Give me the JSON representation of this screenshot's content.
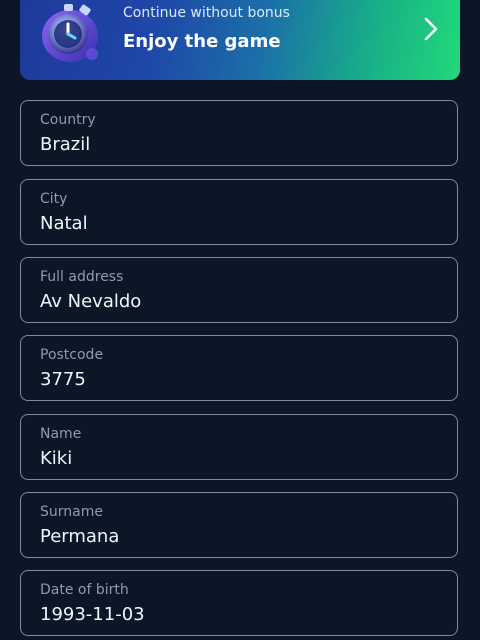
{
  "banner": {
    "subtitle": "Continue without bonus",
    "title": "Enjoy the game",
    "art_icon": "stopwatch-icon",
    "chevron_icon": "chevron-right-icon",
    "gradient_colors": [
      "#1d3a9c",
      "#1b6fa8",
      "#22d97a"
    ]
  },
  "form": {
    "fields": [
      {
        "label": "Country",
        "value": "Brazil"
      },
      {
        "label": "City",
        "value": "Natal"
      },
      {
        "label": "Full address",
        "value": "Av Nevaldo"
      },
      {
        "label": "Postcode",
        "value": "3775"
      },
      {
        "label": "Name",
        "value": "Kiki"
      },
      {
        "label": "Surname",
        "value": "Permana"
      },
      {
        "label": "Date of birth",
        "value": "1993-11-03"
      }
    ]
  },
  "colors": {
    "background": "#0b1626",
    "field_border": "#7d8aa0",
    "label": "#8e9ab0",
    "value": "#f2f5fa"
  }
}
